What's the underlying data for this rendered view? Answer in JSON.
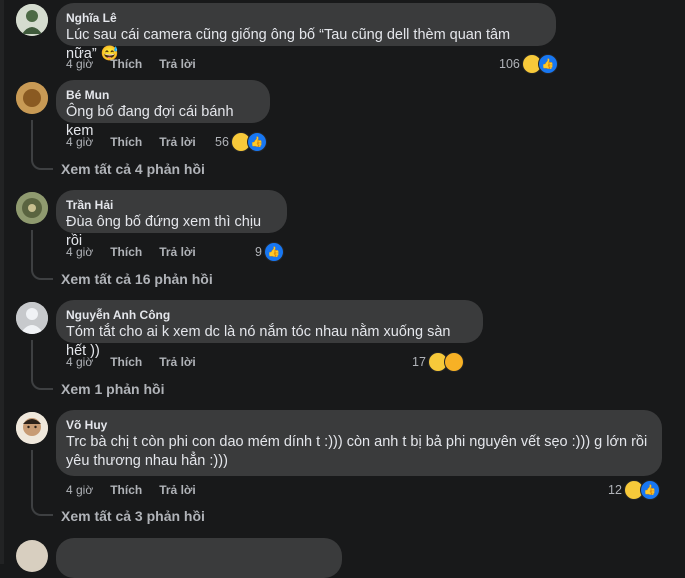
{
  "comments": [
    {
      "name": "Nghĩa Lê",
      "text": "Lúc sau cái camera cũng giống ông bố “Tau cũng dell thèm quan tâm nữa” 😅",
      "time": "4 giờ",
      "like": "Thích",
      "reply": "Trả lời",
      "count": "106",
      "reactions": [
        "haha-icon",
        "like-icon"
      ],
      "replies": ""
    },
    {
      "name": "Bé Mun",
      "text": "Ông bố đang đợi cái bánh kem",
      "time": "4 giờ",
      "like": "Thích",
      "reply": "Trả lời",
      "count": "56",
      "reactions": [
        "haha-icon",
        "like-icon"
      ],
      "replies": "Xem tất cả 4 phản hồi"
    },
    {
      "name": "Trần Hải",
      "text": "Đùa ông bố đứng xem thì chịu rồi",
      "time": "4 giờ",
      "like": "Thích",
      "reply": "Trả lời",
      "count": "9",
      "reactions": [
        "like-icon"
      ],
      "replies": "Xem tất cả 16 phản hồi"
    },
    {
      "name": "Nguyễn Anh Công",
      "text": "Tóm tắt cho ai k xem dc là nó nắm tóc nhau nằm xuống sàn hết ))",
      "time": "4 giờ",
      "like": "Thích",
      "reply": "Trả lời",
      "count": "17",
      "reactions": [
        "haha-icon",
        "care-icon"
      ],
      "replies": "Xem 1 phản hồi"
    },
    {
      "name": "Võ Huy",
      "text": "Trc bà chị t còn phi con dao mém dính t :))) còn anh t bị bả phi nguyên vết sẹo :))) g lớn rồi yêu thương nhau hẳn :)))",
      "time": "4 giờ",
      "like": "Thích",
      "reply": "Trả lời",
      "count": "12",
      "reactions": [
        "haha-icon",
        "like-icon"
      ],
      "replies": "Xem tất cả 3 phản hồi"
    }
  ],
  "colors": {
    "background": "#18191a",
    "bubble": "#3a3b3c",
    "text": "#e4e6eb",
    "secondary": "#b0b3b8",
    "like": "#1877f2",
    "haha": "#f7c93a"
  }
}
